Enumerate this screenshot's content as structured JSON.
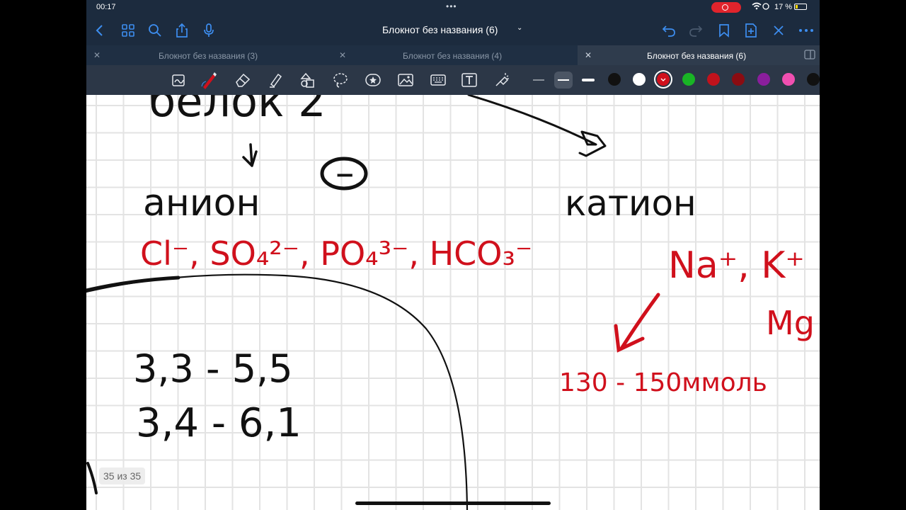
{
  "status_bar": {
    "time": "00:17",
    "battery_percent": "17 %"
  },
  "nav_bar": {
    "document_title": "Блокнот без названия (6)"
  },
  "tabs": [
    {
      "label": "Блокнот без названия (3)",
      "active": false
    },
    {
      "label": "Блокнот без названия (4)",
      "active": false
    },
    {
      "label": "Блокнот без названия (6)",
      "active": true
    }
  ],
  "toolbar": {
    "tools": [
      "lasso-capture-icon",
      "pen-icon",
      "eraser-icon",
      "highlighter-icon",
      "shapes-icon",
      "lasso-icon",
      "sticker-icon",
      "image-icon",
      "keyboard-icon",
      "text-icon",
      "laser-pointer-icon"
    ],
    "selected_tool": "pen-icon",
    "selected_thickness": 2,
    "colors": [
      "#111111",
      "#ffffff",
      "#d0101c",
      "#19b525",
      "#c1121c",
      "#8b0c12",
      "#8a1e9c",
      "#f04fb0",
      "#111111"
    ],
    "selected_color_index": 2
  },
  "page": {
    "counter": "35 из 35"
  },
  "handwriting": {
    "top_fragment": "белок 2",
    "minus_symbol": "−",
    "anion_heading": "анион",
    "anion_ions": "Cl⁻, SO₄²⁻, PO₄³⁻, HCO₃⁻",
    "range_1": "3,3 - 5,5",
    "range_2": "3,4 - 6,1",
    "cation_heading": "катион",
    "cation_ions": "Na⁺, K⁺",
    "cation_partial": "Mg",
    "sodium_range": "130 - 150ммоль"
  },
  "colors": {
    "ink_black": "#111111",
    "ink_red": "#d0101c",
    "ui_dark": "#1c2b3e",
    "accent": "#3d8ef0"
  }
}
